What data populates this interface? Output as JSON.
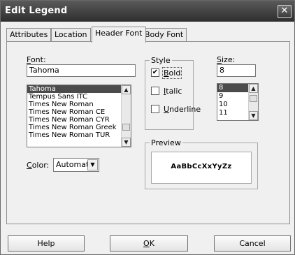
{
  "window": {
    "title": "Edit Legend",
    "close_glyph": "✕"
  },
  "tabs": [
    {
      "label": "Attributes"
    },
    {
      "label": "Location"
    },
    {
      "label": "Header Font",
      "active": true
    },
    {
      "label": "Body Font"
    }
  ],
  "font": {
    "label_accel": "F",
    "label_rest": "ont:",
    "value": "Tahoma",
    "list": [
      "Tahoma",
      "Tempus Sans ITC",
      "Times New Roman",
      "Times New Roman CE",
      "Times New Roman CYR",
      "Times New Roman Greek",
      "Times New Roman TUR"
    ],
    "selected": "Tahoma"
  },
  "style": {
    "title": "Style",
    "bold_accel": "B",
    "bold_rest": "old",
    "bold_checked": true,
    "italic_accel": "I",
    "italic_rest": "talic",
    "italic_checked": false,
    "underline_accel": "U",
    "underline_rest": "nderline",
    "underline_checked": false,
    "check_glyph": "✔"
  },
  "size": {
    "label_accel": "S",
    "label_rest": "ize:",
    "value": "8",
    "list": [
      "8",
      "9",
      "10",
      "11"
    ],
    "selected": "8"
  },
  "color": {
    "label_accel": "C",
    "label_rest": "olor:",
    "value": "Automatic"
  },
  "preview": {
    "title": "Preview",
    "sample": "AaBbCcXxYyZz"
  },
  "buttons": {
    "help": "Help",
    "ok_accel": "O",
    "ok_rest": "K",
    "cancel": "Cancel"
  },
  "icons": {
    "up": "▲",
    "down": "▼",
    "combo_arrow": "▼"
  }
}
